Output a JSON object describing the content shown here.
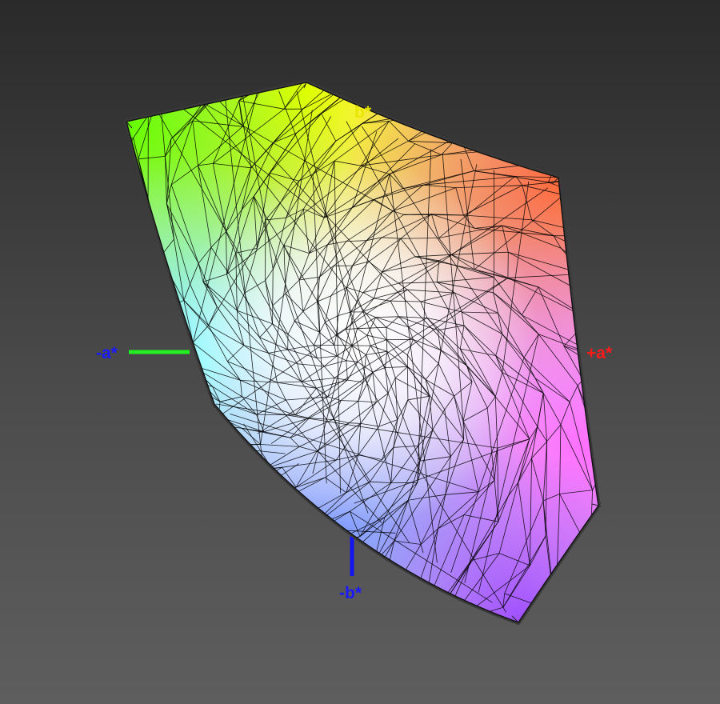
{
  "axes": {
    "minus_a": {
      "label": "-a*",
      "color": "#1a1aff",
      "line_color": "#22ee22"
    },
    "plus_a": {
      "label": "+a*",
      "color": "#ff1a1a",
      "line_color": "#ee2020"
    },
    "plus_b": {
      "label": "b*",
      "color": "#e6e600"
    },
    "minus_b": {
      "label": "-b*",
      "color": "#1a1aff",
      "line_color": "#1515ee"
    }
  },
  "colors": {
    "yellow": "#ffff00",
    "green": "#66ff00",
    "orange": "#ff6a3a",
    "cyan": "#80ffff",
    "magenta": "#ff70ff",
    "blue": "#7f9bff",
    "violet": "#a050ff",
    "white": "#ffffff",
    "wire": "#000000"
  }
}
